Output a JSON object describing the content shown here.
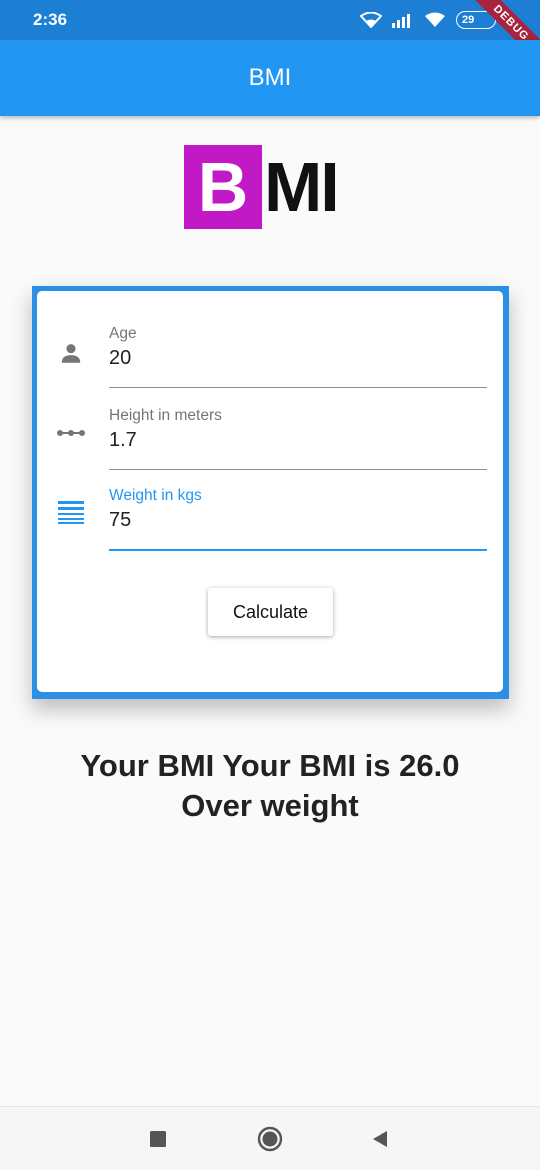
{
  "status_bar": {
    "time": "2:36",
    "battery": "29",
    "debug_label": "DEBUG"
  },
  "app_bar": {
    "title": "BMI"
  },
  "logo": {
    "letter_b": "B",
    "letters_mi": "MI",
    "accent_color": "#c219c7"
  },
  "form": {
    "fields": [
      {
        "label": "Age",
        "value": "20",
        "icon": "person-icon"
      },
      {
        "label": "Height in meters",
        "value": "1.7",
        "icon": "linear-scale-icon"
      },
      {
        "label": "Weight in kgs",
        "value": "75",
        "icon": "weight-lines-icon",
        "focused": true
      }
    ],
    "calculate_label": "Calculate"
  },
  "result": {
    "line1": "Your BMI Your BMI is 26.0",
    "line2": "Over weight"
  },
  "colors": {
    "primary": "#2196f3",
    "status_bar": "#1c7fd4"
  }
}
